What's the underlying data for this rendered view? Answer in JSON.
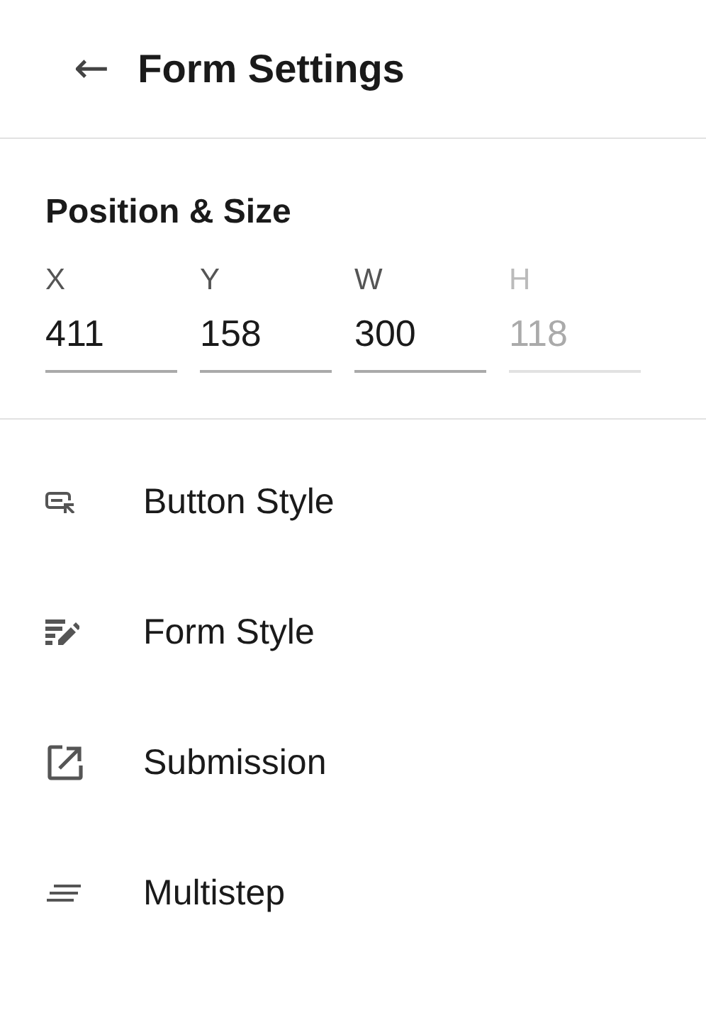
{
  "header": {
    "back_icon": "←",
    "title": "Form Settings"
  },
  "section": {
    "title": "Position & Size",
    "fields": [
      {
        "label": "X",
        "value": "411",
        "disabled": false
      },
      {
        "label": "Y",
        "value": "158",
        "disabled": false
      },
      {
        "label": "W",
        "value": "300",
        "disabled": false
      },
      {
        "label": "H",
        "value": "118",
        "disabled": true
      }
    ]
  },
  "menu": [
    {
      "kind": "button",
      "label": "Button Style"
    },
    {
      "kind": "form",
      "label": "Form Style"
    },
    {
      "kind": "external",
      "label": "Submission"
    },
    {
      "kind": "lines",
      "label": "Multistep"
    }
  ]
}
